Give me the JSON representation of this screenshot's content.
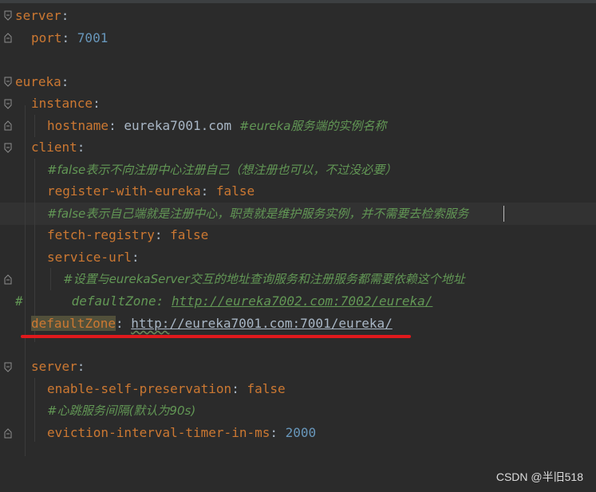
{
  "editor": {
    "lines": [
      {
        "key": "server",
        "sep": ":"
      },
      {
        "key": "port",
        "sep": ": ",
        "value": "7001"
      },
      {
        "key": "eureka",
        "sep": ":"
      },
      {
        "key": "instance",
        "sep": ":"
      },
      {
        "key": "hostname",
        "sep": ": ",
        "value": "eureka7001.com",
        "comment": "#eureka服务端的实例名称"
      },
      {
        "key": "client",
        "sep": ":"
      },
      {
        "comment": "#false表示不向注册中心注册自己（想注册也可以，不过没必要）"
      },
      {
        "key": "register-with-eureka",
        "sep": ": ",
        "value": "false"
      },
      {
        "comment": "#false表示自己端就是注册中心，职责就是维护服务实例，并不需要去检索服务"
      },
      {
        "key": "fetch-registry",
        "sep": ": ",
        "value": "false"
      },
      {
        "key": "service-url",
        "sep": ":"
      },
      {
        "comment": "#设置与eurekaServer交互的地址查询服务和注册服务都需要依赖这个地址"
      },
      {
        "hash": "#",
        "key": "defaultZone",
        "sep": ": ",
        "value": "http://eureka7002.com:7002/eureka/"
      },
      {
        "key": "defaultZone",
        "sep": ": ",
        "value_a": "http:",
        "value_b": "//eureka7001.com:7001/eureka/"
      },
      {
        "key": "server",
        "sep": ":"
      },
      {
        "key": "enable-self-preservation",
        "sep": ": ",
        "value": "false"
      },
      {
        "comment": "#心跳服务间隔(默认为90s)"
      },
      {
        "key": "eviction-interval-timer-in-ms",
        "sep": ": ",
        "value": "2000"
      }
    ]
  },
  "colors": {
    "background": "#2b2b2b",
    "key": "#cc7832",
    "number": "#6897bb",
    "comment": "#629755",
    "highlight": "#52503a",
    "annotation_underline": "#e0191c"
  },
  "watermark": "CSDN @半旧518"
}
